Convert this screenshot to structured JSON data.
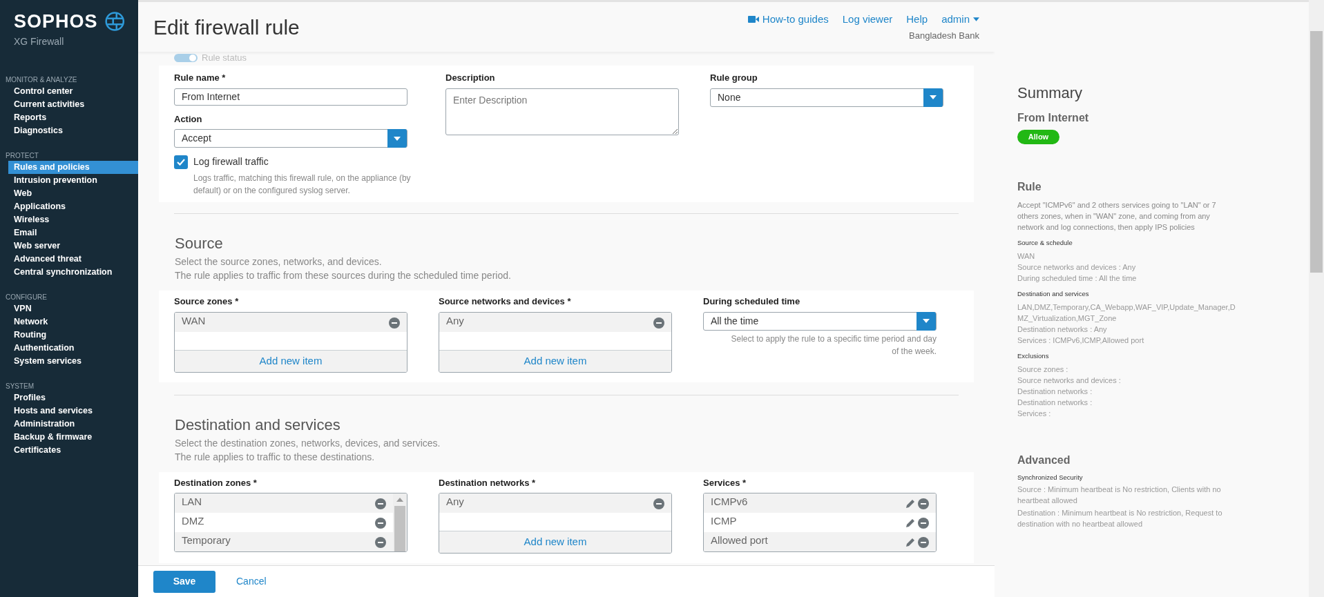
{
  "brand": {
    "name": "SOPHOS",
    "product": "XG Firewall"
  },
  "sidebar": [
    {
      "heading": "MONITOR & ANALYZE",
      "items": [
        {
          "label": "Control center",
          "selected": false
        },
        {
          "label": "Current activities",
          "selected": false
        },
        {
          "label": "Reports",
          "selected": false
        },
        {
          "label": "Diagnostics",
          "selected": false
        }
      ]
    },
    {
      "heading": "PROTECT",
      "items": [
        {
          "label": "Rules and policies",
          "selected": true
        },
        {
          "label": "Intrusion prevention",
          "selected": false
        },
        {
          "label": "Web",
          "selected": false
        },
        {
          "label": "Applications",
          "selected": false
        },
        {
          "label": "Wireless",
          "selected": false
        },
        {
          "label": "Email",
          "selected": false
        },
        {
          "label": "Web server",
          "selected": false
        },
        {
          "label": "Advanced threat",
          "selected": false
        },
        {
          "label": "Central synchronization",
          "selected": false
        }
      ]
    },
    {
      "heading": "CONFIGURE",
      "items": [
        {
          "label": "VPN",
          "selected": false
        },
        {
          "label": "Network",
          "selected": false
        },
        {
          "label": "Routing",
          "selected": false
        },
        {
          "label": "Authentication",
          "selected": false
        },
        {
          "label": "System services",
          "selected": false
        }
      ]
    },
    {
      "heading": "SYSTEM",
      "items": [
        {
          "label": "Profiles",
          "selected": false
        },
        {
          "label": "Hosts and services",
          "selected": false
        },
        {
          "label": "Administration",
          "selected": false
        },
        {
          "label": "Backup & firmware",
          "selected": false
        },
        {
          "label": "Certificates",
          "selected": false
        }
      ]
    }
  ],
  "header": {
    "title": "Edit firewall rule",
    "links": [
      "How-to guides",
      "Log viewer",
      "Help"
    ],
    "user": "admin",
    "organization": "Bangladesh Bank"
  },
  "rule_status": {
    "label": "Rule status",
    "on": true
  },
  "general": {
    "rule_name": {
      "label": "Rule name *",
      "value": "From Internet"
    },
    "action": {
      "label": "Action",
      "value": "Accept"
    },
    "log": {
      "label": "Log firewall traffic",
      "checked": true,
      "hint": "Logs traffic, matching this firewall rule, on the appliance (by default) or on the configured syslog server."
    },
    "description": {
      "label": "Description",
      "placeholder": "Enter Description"
    },
    "rule_group": {
      "label": "Rule group",
      "value": "None"
    }
  },
  "source": {
    "title": "Source",
    "lines": [
      "Select the source zones, networks, and devices.",
      "The rule applies to traffic from these sources during the scheduled time period."
    ],
    "zones": {
      "label": "Source zones *",
      "items": [
        "WAN"
      ],
      "add": "Add new item"
    },
    "networks": {
      "label": "Source networks and devices *",
      "items": [
        "Any"
      ],
      "add": "Add new item"
    },
    "schedule": {
      "label": "During scheduled time",
      "value": "All the time",
      "hint": "Select to apply the rule to a specific time period and day of the week."
    }
  },
  "destination": {
    "title": "Destination and services",
    "lines": [
      "Select the destination zones, networks, devices, and services.",
      "The rule applies to traffic to these destinations."
    ],
    "zones": {
      "label": "Destination zones *",
      "items": [
        "LAN",
        "DMZ",
        "Temporary"
      ]
    },
    "networks": {
      "label": "Destination networks *",
      "items": [
        "Any"
      ],
      "add": "Add new item"
    },
    "services": {
      "label": "Services *",
      "items": [
        "ICMPv6",
        "ICMP",
        "Allowed port"
      ]
    }
  },
  "footer": {
    "save": "Save",
    "cancel": "Cancel"
  },
  "summary": {
    "title": "Summary",
    "rule_name": "From Internet",
    "badge": "Allow",
    "rule_title": "Rule",
    "rule_text": "Accept \"ICMPv6\" and 2 others services going to \"LAN\" or 7 others zones, when in \"WAN\" zone, and coming from any network and log connections, then apply IPS policies",
    "groups": [
      {
        "heading": "Source & schedule",
        "lines": [
          "WAN",
          "Source networks and devices : Any",
          "During scheduled time : All the time"
        ]
      },
      {
        "heading": "Destination and services",
        "lines": [
          "LAN,DMZ,Temporary,CA_Webapp,WAF_VIP,Update_Manager,DMZ_Virtualization,MGT_Zone",
          "Destination networks : Any",
          "Services : ICMPv6,ICMP,Allowed port"
        ]
      },
      {
        "heading": "Exclusions",
        "lines": [
          "Source zones :",
          "Source networks and devices :",
          "Destination networks :",
          "Destination networks :",
          "Services :"
        ]
      }
    ],
    "advanced_title": "Advanced",
    "advanced_heading": "Synchronized Security",
    "advanced_lines": [
      "Source : Minimum heartbeat is No restriction, Clients with no heartbeat allowed",
      "Destination : Minimum heartbeat is No restriction, Request to destination with no heartbeat allowed"
    ]
  }
}
